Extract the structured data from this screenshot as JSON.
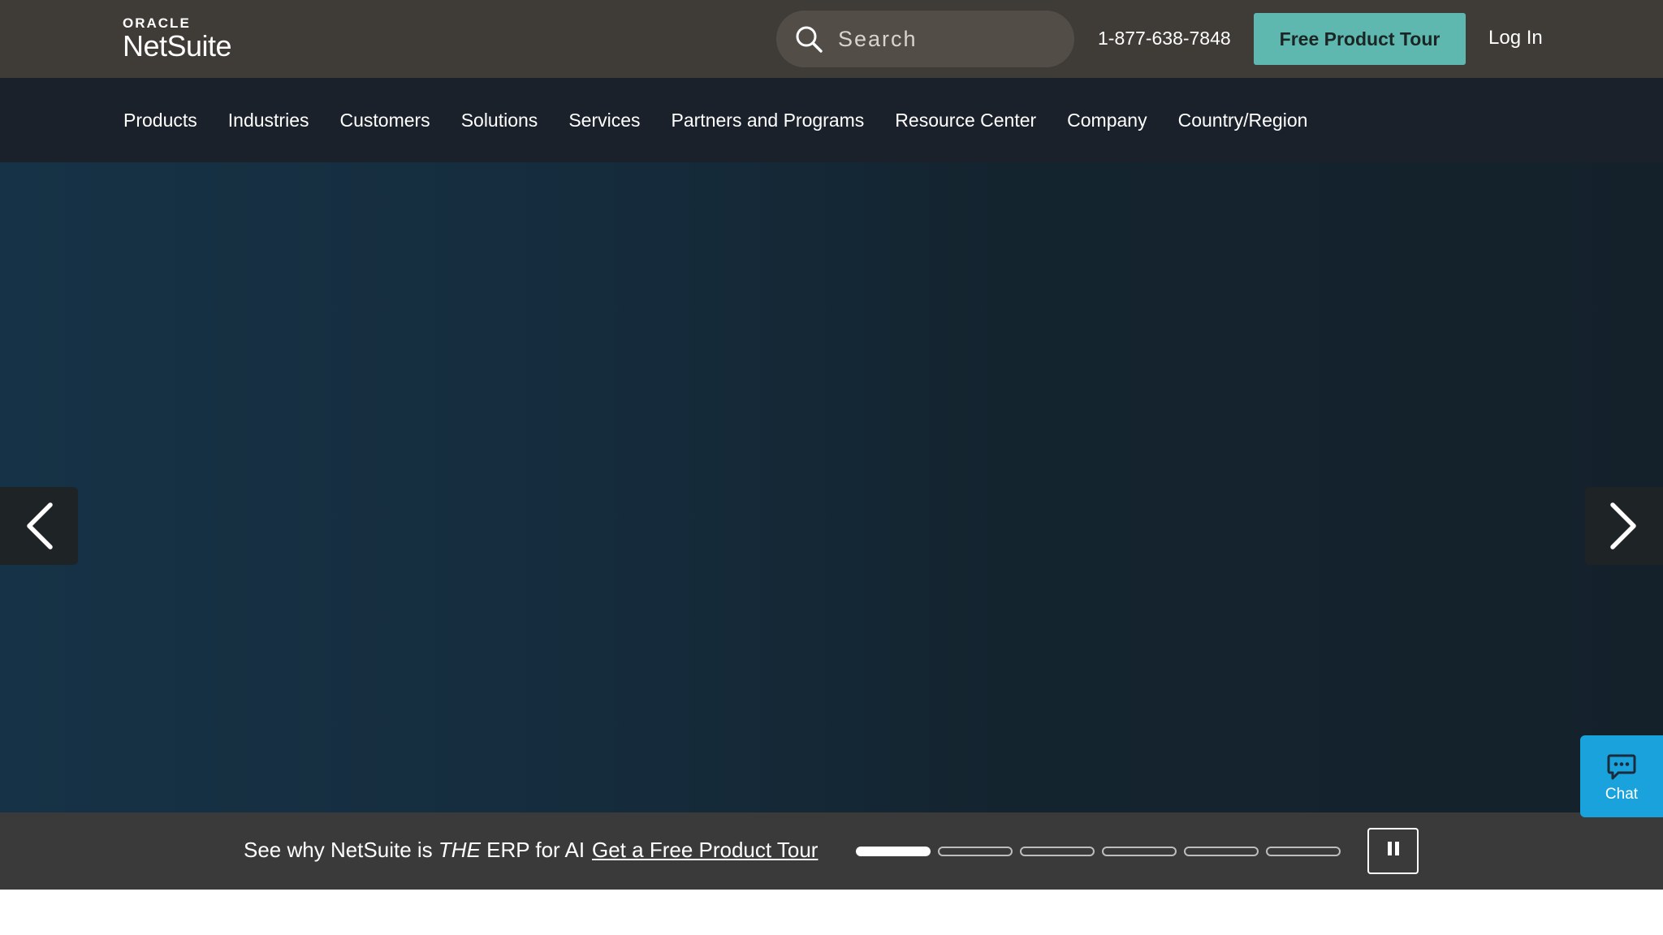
{
  "header": {
    "logo_top": "ORACLE",
    "logo_main": "NetSuite",
    "search_placeholder": "Search",
    "phone": "1-877-638-7848",
    "tour_button": "Free Product Tour",
    "login": "Log In"
  },
  "nav": {
    "items": [
      {
        "label": "Products"
      },
      {
        "label": "Industries"
      },
      {
        "label": "Customers"
      },
      {
        "label": "Solutions"
      },
      {
        "label": "Services"
      },
      {
        "label": "Partners and Programs"
      },
      {
        "label": "Resource Center"
      },
      {
        "label": "Company"
      },
      {
        "label": "Country/Region"
      }
    ]
  },
  "hero": {
    "prev_icon": "chevron-left-icon",
    "next_icon": "chevron-right-icon"
  },
  "carousel": {
    "caption_prefix": "See why NetSuite is",
    "caption_emphasis": "THE",
    "caption_suffix": "ERP for AI",
    "link": "Get a Free Product Tour",
    "slide_count": 6,
    "active_slide": 1,
    "pause_icon": "pause-icon"
  },
  "chat": {
    "label": "Chat",
    "icon": "chat-bubble-icon"
  },
  "colors": {
    "topbar": "#3f3b36",
    "nav": "#1b212a",
    "accent_teal": "#5eb8b0",
    "chat_blue": "#1aa2dd",
    "carousel_bar": "#3a3a3a"
  }
}
